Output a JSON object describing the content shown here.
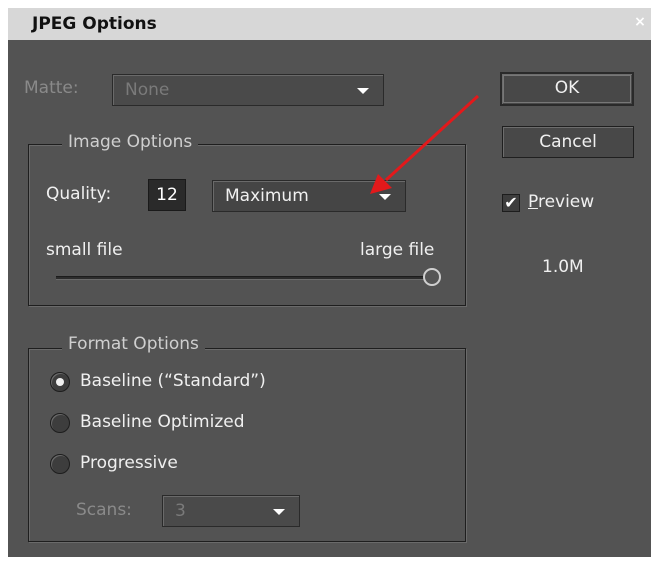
{
  "window": {
    "title": "JPEG Options",
    "close_glyph": "×"
  },
  "matte": {
    "label": "Matte:",
    "value": "None"
  },
  "image_options": {
    "legend": "Image Options",
    "quality_label": "Quality:",
    "quality_value": "12",
    "quality_preset": "Maximum",
    "small_label": "small file",
    "large_label": "large file",
    "slider_level": 1.0
  },
  "format_options": {
    "legend": "Format Options",
    "radios": [
      {
        "label": "Baseline (“Standard”)",
        "selected": true
      },
      {
        "label": "Baseline Optimized",
        "selected": false
      },
      {
        "label": "Progressive",
        "selected": false
      }
    ],
    "scans_label": "Scans:",
    "scans_value": "3"
  },
  "buttons": {
    "ok": "OK",
    "cancel": "Cancel"
  },
  "preview": {
    "label": "Preview",
    "checked": true,
    "check_glyph": "✔"
  },
  "file_size": "1.0M",
  "annotation": {
    "arrow_color": "#e3191b"
  }
}
